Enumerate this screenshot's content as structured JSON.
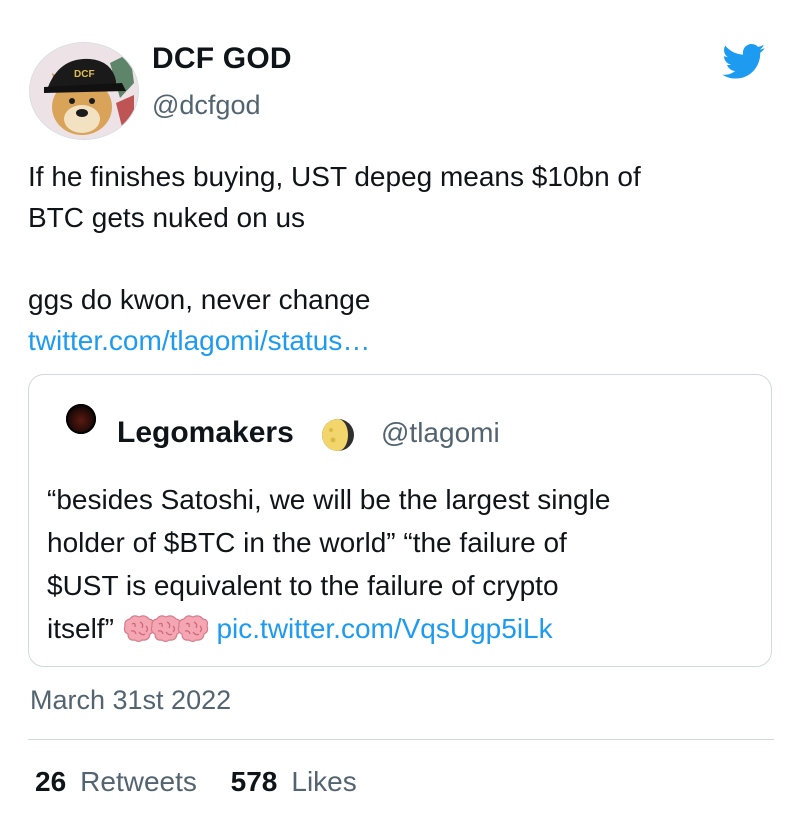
{
  "author": {
    "name": "DCF GOD",
    "handle": "@dcfgod",
    "avatar_cap_text": "DCF"
  },
  "tweet": {
    "lines": [
      "If he finishes buying, UST depeg means $10bn of",
      "BTC gets nuked on us",
      "ggs do kwon, never change"
    ],
    "link": "twitter.com/tlagomi/status…"
  },
  "quoted": {
    "name": "Legomakers",
    "handle": "@tlagomi",
    "lines": [
      "“besides Satoshi, we will be the largest single",
      "holder of $BTC in the world” “the failure of",
      "$UST is equivalent to the failure of crypto",
      "itself”"
    ],
    "link": "pic.twitter.com/VqsUgp5iLk",
    "brain_emoji_count": 3,
    "moon_icon": "waning-crescent-moon-icon"
  },
  "timestamp": "March 31st 2022",
  "stats": {
    "retweets_count": "26",
    "retweets_label": "Retweets",
    "likes_count": "578",
    "likes_label": "Likes"
  },
  "colors": {
    "link": "#1d9bf0",
    "secondary_text": "#536471",
    "border": "#cfd9de",
    "twitter_blue": "#1d9bf0"
  }
}
